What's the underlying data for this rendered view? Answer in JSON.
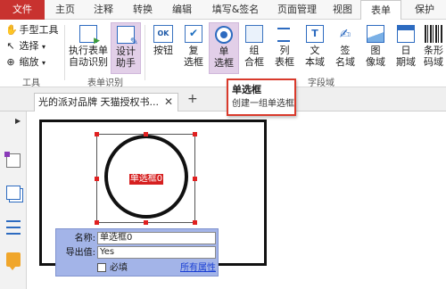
{
  "tabs": [
    {
      "label": "文件"
    },
    {
      "label": "主页"
    },
    {
      "label": "注释"
    },
    {
      "label": "转换"
    },
    {
      "label": "编辑"
    },
    {
      "label": "填写&签名"
    },
    {
      "label": "页面管理"
    },
    {
      "label": "视图"
    },
    {
      "label": "表单"
    },
    {
      "label": "保护"
    }
  ],
  "active_tab": "表单",
  "ribbon": {
    "tools": {
      "hand": "手型工具",
      "select": "选择",
      "zoom": "缩放",
      "group_label": "工具"
    },
    "form_recognition": {
      "run_label_1": "执行表单",
      "run_label_2": "自动识别",
      "design_label_1": "设计",
      "design_label_2": "助手",
      "group_label": "表单识别"
    },
    "form_fields": {
      "button_label": "按钮",
      "checkbox_label_1": "复",
      "checkbox_label_2": "选框",
      "radio_label_1": "单",
      "radio_label_2": "选框",
      "combo_label_1": "组",
      "combo_label_2": "合框",
      "list_label_1": "列",
      "list_label_2": "表框",
      "text_label_1": "文",
      "text_label_2": "本域",
      "sign_label_1": "签",
      "sign_label_2": "名域",
      "image_label_1": "图",
      "image_label_2": "像域",
      "date_label_1": "日",
      "date_label_2": "期域",
      "barcode_label_1": "条形",
      "barcode_label_2": "码域",
      "ok_icon_text": "OK",
      "text_icon_text": "T",
      "group_label": "字段域"
    }
  },
  "tooltip": {
    "title": "单选框",
    "description": "创建一组单选框"
  },
  "document": {
    "tab_title": "光的派对品牌 天猫授权书...",
    "close_glyph": "✕",
    "new_tab_glyph": "+"
  },
  "radio_field": {
    "label": "单选框0"
  },
  "properties": {
    "name_label": "名称:",
    "name_value": "单选框0",
    "export_label": "导出值:",
    "export_value": "Yes",
    "required_label": "必填",
    "all_props_link": "所有属性"
  },
  "colors": {
    "file_tab": "#c8322f",
    "selected_tool": "#e2cfe8",
    "tooltip_border": "#d93a2c",
    "handle": "#e02020",
    "props_bg": "#a3b4e8"
  }
}
